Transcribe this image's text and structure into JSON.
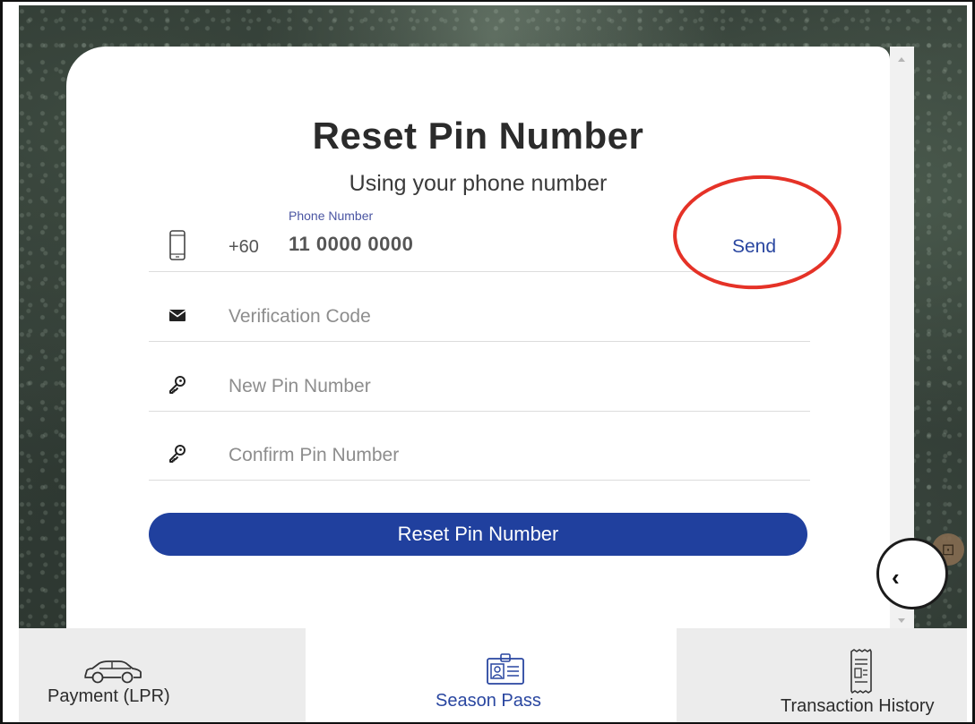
{
  "header": {
    "title": "Reset Pin Number",
    "subtitle": "Using your phone number"
  },
  "form": {
    "phone": {
      "label": "Phone Number",
      "country_code": "+60",
      "value": "11 0000 0000",
      "send_label": "Send",
      "icon": "mobile-phone-icon"
    },
    "verification_code": {
      "placeholder": "Verification Code",
      "icon": "envelope-icon"
    },
    "new_pin": {
      "placeholder": "New Pin Number",
      "icon": "key-icon"
    },
    "confirm_pin": {
      "placeholder": "Confirm Pin Number",
      "icon": "key-icon"
    },
    "submit_label": "Reset Pin Number"
  },
  "bottom_nav": {
    "items": [
      {
        "label": "Payment (LPR)",
        "icon": "car-icon",
        "active": false
      },
      {
        "label": "Season Pass",
        "icon": "id-card-icon",
        "active": true
      },
      {
        "label": "Transaction History",
        "icon": "receipt-icon",
        "active": false
      }
    ]
  },
  "colors": {
    "primary": "#20409e",
    "link": "#2946a0",
    "annotation": "#e53227"
  }
}
